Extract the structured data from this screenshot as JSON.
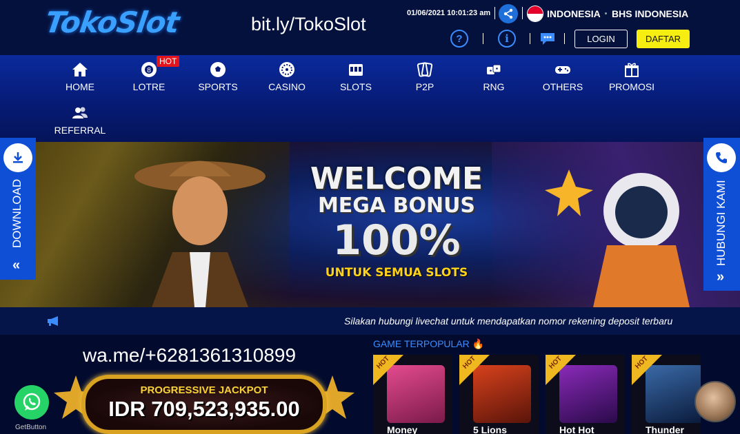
{
  "header": {
    "logo_text": "TokoSlot",
    "site_url": "bit.ly/TokoSlot",
    "datetime": "01/06/2021 10:01:23 am",
    "country": "INDONESIA",
    "language": "BHS INDONESIA",
    "login_label": "LOGIN",
    "register_label": "DAFTAR",
    "colors": {
      "accent": "#1e6fd9",
      "register_bg": "#f5ee10"
    }
  },
  "nav": {
    "items": [
      {
        "label": "HOME",
        "icon": "home-icon"
      },
      {
        "label": "LOTRE",
        "icon": "lottery-ball-icon"
      },
      {
        "label": "SPORTS",
        "icon": "soccer-ball-icon"
      },
      {
        "label": "CASINO",
        "icon": "roulette-icon"
      },
      {
        "label": "SLOTS",
        "icon": "slot-machine-icon"
      },
      {
        "label": "P2P",
        "icon": "cards-icon"
      },
      {
        "label": "RNG",
        "icon": "dice-icon"
      },
      {
        "label": "OTHERS",
        "icon": "gamepad-icon"
      },
      {
        "label": "PROMOSI",
        "icon": "gift-icon"
      },
      {
        "label": "REFERRAL",
        "icon": "users-icon"
      }
    ],
    "hot_badge": "HOT"
  },
  "banner": {
    "line1": "WELCOME",
    "line2": "MEGA BONUS",
    "line3": "100%",
    "line4": "UNTUK SEMUA SLOTS"
  },
  "side": {
    "left_label": "DOWNLOAD",
    "right_label": "HUBUNGI KAMI"
  },
  "marquee": {
    "text": "Silakan hubungi livechat untuk mendapatkan nomor rekening deposit terbaru"
  },
  "contact": {
    "wa_link": "wa.me/+6281361310899",
    "getbutton_label": "GetButton"
  },
  "jackpot": {
    "label": "PROGRESSIVE JACKPOT",
    "value": "IDR 709,523,935.00"
  },
  "popular": {
    "title": "GAME TERPOPULAR",
    "games": [
      {
        "name": "Money",
        "badge": "HOT",
        "color": "#e44b8e"
      },
      {
        "name": "5 Lions",
        "badge": "HOT",
        "color": "#b8321c"
      },
      {
        "name": "Hot Hot",
        "badge": "HOT",
        "color": "#6a1a8a"
      },
      {
        "name": "Thunder",
        "badge": "HOT",
        "color": "#1a3a6a"
      }
    ]
  }
}
